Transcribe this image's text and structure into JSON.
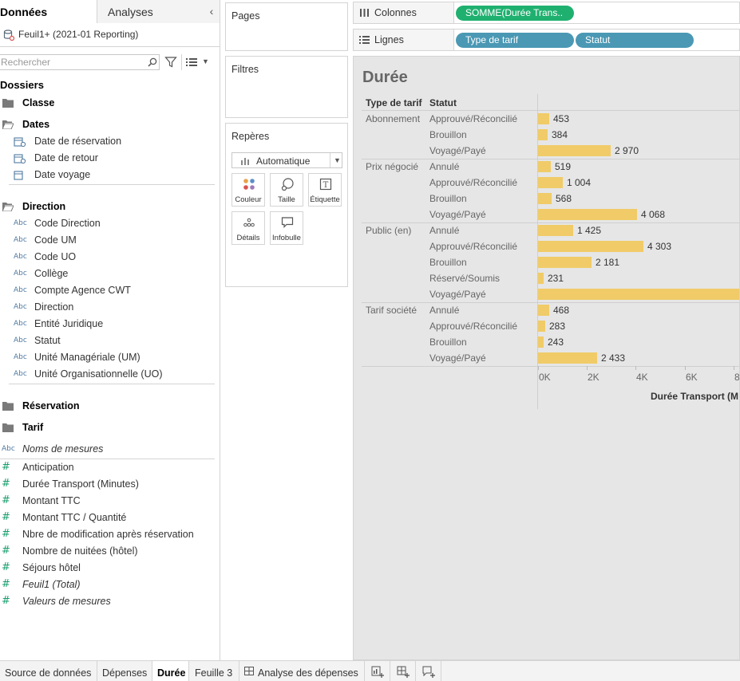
{
  "left_pane": {
    "tabs": {
      "data": "Données",
      "analytics": "Analyses"
    },
    "datasource": "Feuil1+ (2021-01 Reporting)",
    "search_placeholder": "Rechercher",
    "folders_title": "Dossiers",
    "folders": {
      "classe": "Classe",
      "dates": "Dates",
      "dates_fields": [
        "Date de réservation",
        "Date de retour",
        "Date voyage"
      ],
      "direction": "Direction",
      "direction_fields": [
        "Code Direction",
        "Code UM",
        "Code UO",
        "Collège",
        "Compte Agence CWT",
        "Direction",
        "Entité Juridique",
        "Statut",
        "Unité Managériale (UM)",
        "Unité Organisationnelle (UO)"
      ],
      "reservation": "Réservation",
      "tarif": "Tarif"
    },
    "measure_names": "Noms de mesures",
    "measures": [
      "Anticipation",
      "Durée Transport (Minutes)",
      "Montant TTC",
      "Montant TTC / Quantité",
      "Nbre de modification après réservation",
      "Nombre de nuitées (hôtel)",
      "Séjours hôtel",
      "Feuil1 (Total)",
      "Valeurs de mesures"
    ],
    "type_badge": "Abc"
  },
  "mid_pane": {
    "pages": "Pages",
    "filters": "Filtres",
    "marks": "Repères",
    "mark_type": "Automatique",
    "mark_buttons": {
      "color": "Couleur",
      "size": "Taille",
      "label": "Étiquette",
      "detail": "Détails",
      "tooltip": "Infobulle"
    }
  },
  "shelves": {
    "columns_label": "Colonnes",
    "columns_pill": "SOMME(Durée Trans..",
    "rows_label": "Lignes",
    "rows_pills": [
      "Type de tarif",
      "Statut"
    ]
  },
  "viz": {
    "title": "Durée",
    "header_group": "Type de tarif",
    "header_status": "Statut",
    "x_ticks": [
      "0K",
      "2K",
      "4K",
      "6K",
      "8K"
    ],
    "x_label": "Durée Transport (M",
    "bar_color": "#f0cb68"
  },
  "chart_data": {
    "type": "bar",
    "orientation": "horizontal",
    "title": "Durée",
    "xlabel": "Durée Transport (M",
    "xlim": [
      0,
      8500
    ],
    "groups": [
      {
        "name": "Abonnement",
        "rows": [
          {
            "status": "Approuvé/Réconcilié",
            "value": 453,
            "label": "453"
          },
          {
            "status": "Brouillon",
            "value": 384,
            "label": "384"
          },
          {
            "status": "Voyagé/Payé",
            "value": 2970,
            "label": "2 970"
          }
        ]
      },
      {
        "name": "Prix négocié",
        "rows": [
          {
            "status": "Annulé",
            "value": 519,
            "label": "519"
          },
          {
            "status": "Approuvé/Réconcilié",
            "value": 1004,
            "label": "1 004"
          },
          {
            "status": "Brouillon",
            "value": 568,
            "label": "568"
          },
          {
            "status": "Voyagé/Payé",
            "value": 4068,
            "label": "4 068"
          }
        ]
      },
      {
        "name": "Public (en)",
        "rows": [
          {
            "status": "Annulé",
            "value": 1425,
            "label": "1 425"
          },
          {
            "status": "Approuvé/Réconcilié",
            "value": 4303,
            "label": "4 303"
          },
          {
            "status": "Brouillon",
            "value": 2181,
            "label": "2 181"
          },
          {
            "status": "Réservé/Soumis",
            "value": 231,
            "label": "231"
          },
          {
            "status": "Voyagé/Payé",
            "value": 9000,
            "label": ""
          }
        ]
      },
      {
        "name": "Tarif société",
        "rows": [
          {
            "status": "Annulé",
            "value": 468,
            "label": "468"
          },
          {
            "status": "Approuvé/Réconcilié",
            "value": 283,
            "label": "283"
          },
          {
            "status": "Brouillon",
            "value": 243,
            "label": "243"
          },
          {
            "status": "Voyagé/Payé",
            "value": 2433,
            "label": "2 433"
          }
        ]
      }
    ]
  },
  "bottom_tabs": {
    "source": "Source de données",
    "sheets": [
      "Dépenses",
      "Durée",
      "Feuille 3"
    ],
    "dashboard": "Analyse des dépenses"
  }
}
